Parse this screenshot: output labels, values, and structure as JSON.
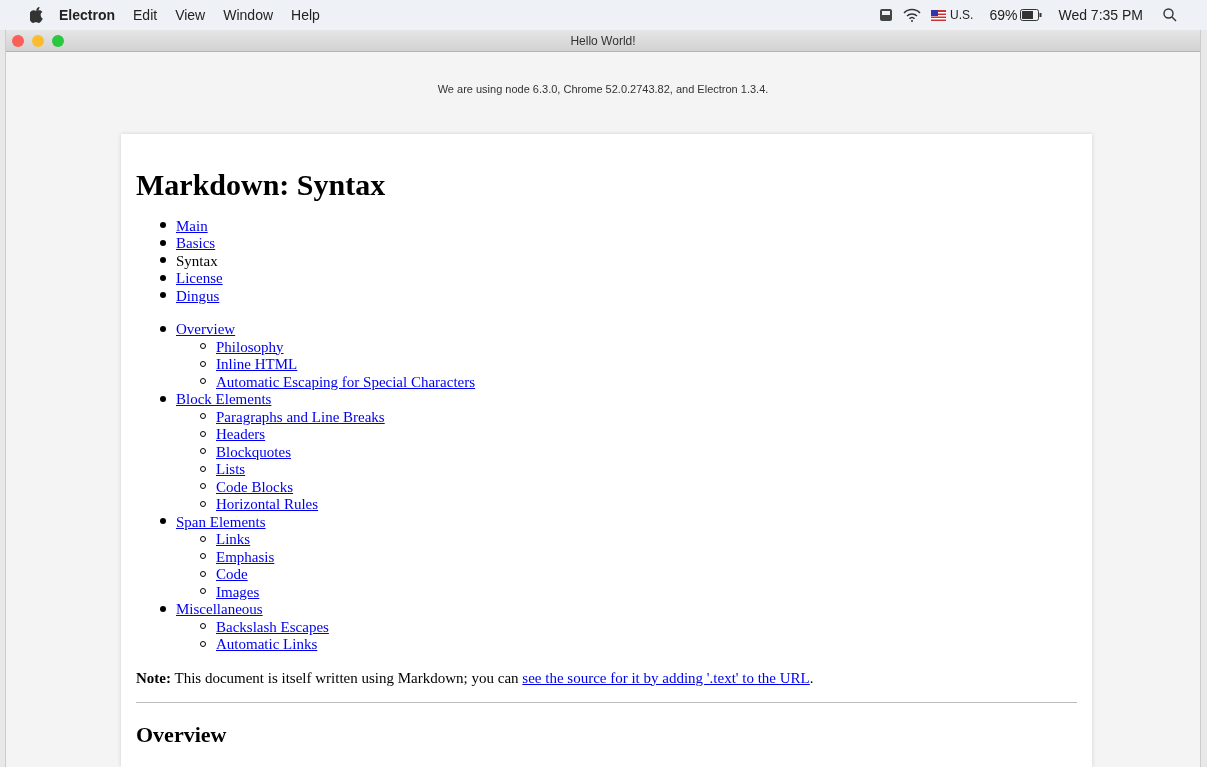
{
  "menu_bar": {
    "app": "Electron",
    "items": [
      "Edit",
      "View",
      "Window",
      "Help"
    ],
    "input_source": "U.S.",
    "battery": "69%",
    "clock": "Wed 7:35 PM"
  },
  "window": {
    "title": "Hello World!"
  },
  "versions_text": "We are using node 6.3.0, Chrome 52.0.2743.82, and Electron 1.3.4.",
  "document": {
    "title": "Markdown: Syntax",
    "nav": [
      {
        "label": "Main",
        "kind": "link"
      },
      {
        "label": "Basics",
        "kind": "link"
      },
      {
        "label": "Syntax",
        "kind": "text"
      },
      {
        "label": "License",
        "kind": "link"
      },
      {
        "label": "Dingus",
        "kind": "link"
      }
    ],
    "toc": [
      {
        "label": "Overview",
        "children": [
          {
            "label": "Philosophy"
          },
          {
            "label": "Inline HTML"
          },
          {
            "label": "Automatic Escaping for Special Characters"
          }
        ]
      },
      {
        "label": "Block Elements",
        "children": [
          {
            "label": "Paragraphs and Line Breaks"
          },
          {
            "label": "Headers"
          },
          {
            "label": "Blockquotes"
          },
          {
            "label": "Lists"
          },
          {
            "label": "Code Blocks"
          },
          {
            "label": "Horizontal Rules"
          }
        ]
      },
      {
        "label": "Span Elements",
        "children": [
          {
            "label": "Links"
          },
          {
            "label": "Emphasis"
          },
          {
            "label": "Code"
          },
          {
            "label": "Images"
          }
        ]
      },
      {
        "label": "Miscellaneous",
        "children": [
          {
            "label": "Backslash Escapes"
          },
          {
            "label": "Automatic Links"
          }
        ]
      }
    ],
    "note": {
      "text": "**Note:** This document is itself written using Markdown; you can ",
      "link": "see the source for it by adding '.text' to the URL",
      "end": "."
    },
    "section_heading": "Overview"
  }
}
